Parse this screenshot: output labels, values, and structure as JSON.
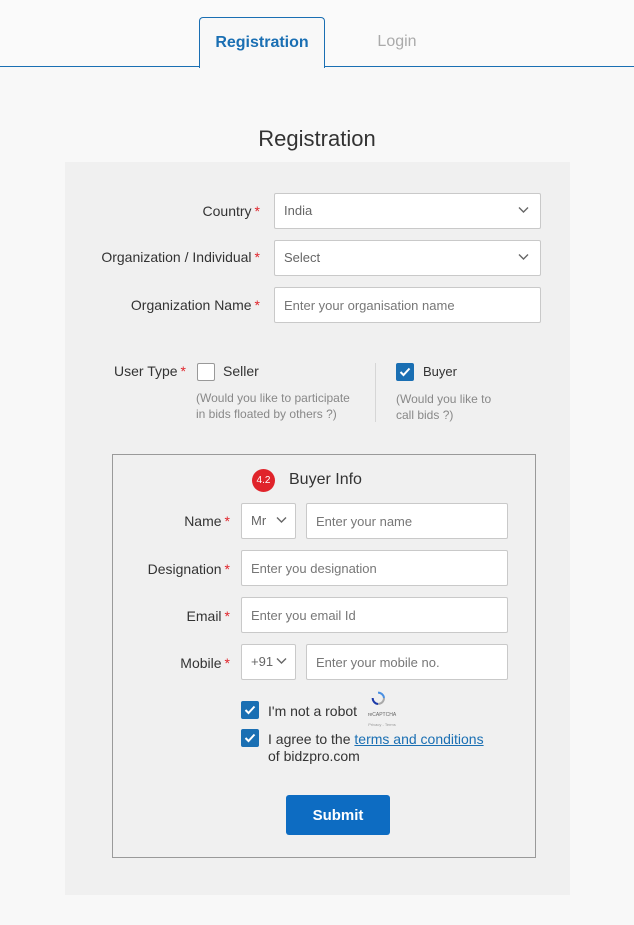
{
  "tabs": [
    {
      "label": "Registration",
      "active": true
    },
    {
      "label": "Login",
      "active": false
    }
  ],
  "page_title": "Registration",
  "form": {
    "country": {
      "label": "Country",
      "value": "India"
    },
    "org_type": {
      "label": "Organization / Individual",
      "value": "Select"
    },
    "org_name": {
      "label": "Organization Name",
      "placeholder": "Enter your organisation name"
    },
    "user_type": {
      "label": "User Type",
      "seller": {
        "label": "Seller",
        "checked": false,
        "hint_line1": "(Would you like to participate",
        "hint_line2": "in bids floated by others ?)"
      },
      "buyer": {
        "label": "Buyer",
        "checked": true,
        "hint_line1": "(Would you like to",
        "hint_line2": "call bids ?)"
      }
    },
    "required_mark": "*"
  },
  "buyer_info": {
    "badge": "4.2",
    "title": "Buyer Info",
    "name": {
      "label": "Name",
      "salutation": "Mr",
      "placeholder": "Enter your name"
    },
    "designation": {
      "label": "Designation",
      "placeholder": "Enter you designation"
    },
    "email": {
      "label": "Email",
      "placeholder": "Enter you email Id"
    },
    "mobile": {
      "label": "Mobile",
      "code": "+91",
      "placeholder": "Enter your mobile no."
    },
    "robot": {
      "label": "I'm not a robot",
      "checked": true,
      "recaptcha_label": "reCAPTCHA",
      "recaptcha_sub": "Privacy - Terms"
    },
    "terms": {
      "prefix": "I agree to the ",
      "link": "terms and conditions",
      "suffix": "of bidzpro.com",
      "checked": true
    },
    "submit_label": "Submit"
  },
  "colors": {
    "accent": "#1a6fb3",
    "required": "#e0242b",
    "button": "#0d6cc2"
  }
}
